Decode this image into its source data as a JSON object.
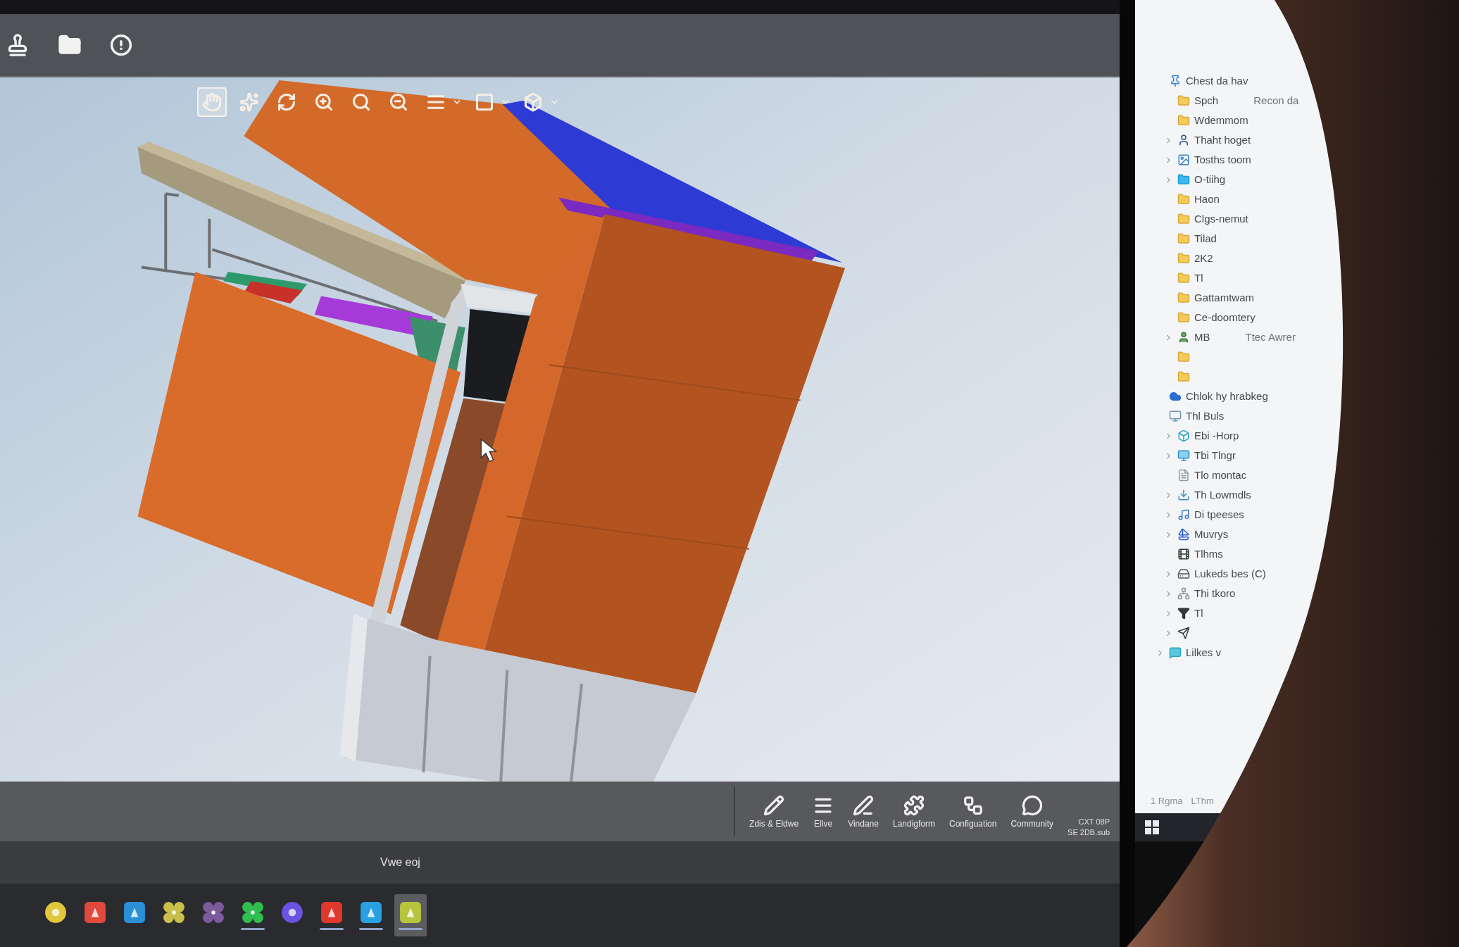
{
  "viewport_toolbar": {
    "tools": [
      {
        "selected": true,
        "dropdown": false
      },
      {
        "selected": false,
        "dropdown": false
      },
      {
        "selected": false,
        "dropdown": false
      },
      {
        "selected": false,
        "dropdown": false
      },
      {
        "selected": false,
        "dropdown": false
      },
      {
        "selected": false,
        "dropdown": false
      },
      {
        "selected": false,
        "dropdown": true
      },
      {
        "selected": false,
        "dropdown": true
      },
      {
        "selected": false,
        "dropdown": true
      }
    ]
  },
  "ribbon": {
    "tools": [
      {
        "label": "Zdis & Eldwe"
      },
      {
        "label": "Ellve"
      },
      {
        "label": "Vindane"
      },
      {
        "label": "Landigform"
      },
      {
        "label": "Configuation"
      },
      {
        "label": "Community"
      }
    ],
    "clock": {
      "time": "CXT 08P",
      "date": "SE 2DB.sub"
    }
  },
  "monitor": {
    "label": "Vwe eoj"
  },
  "taskbar": {
    "apps": [
      {
        "kind": "circle",
        "color": "#e2c63c",
        "running": false,
        "selected": false
      },
      {
        "kind": "square",
        "color": "#e04a3c",
        "running": false,
        "selected": false
      },
      {
        "kind": "square",
        "color": "#2b8fd8",
        "running": false,
        "selected": false
      },
      {
        "kind": "cluster",
        "color": "#c8c04a",
        "running": false,
        "selected": false
      },
      {
        "kind": "cluster",
        "color": "#7c5a9c",
        "running": false,
        "selected": false
      },
      {
        "kind": "cluster",
        "color": "#2fbf4f",
        "running": true,
        "selected": false
      },
      {
        "kind": "circle",
        "color": "#6b52e0",
        "running": false,
        "selected": false
      },
      {
        "kind": "square",
        "color": "#e0382c",
        "running": true,
        "selected": false
      },
      {
        "kind": "square",
        "color": "#2a9fe2",
        "running": true,
        "selected": false
      },
      {
        "kind": "square",
        "color": "#b8c43c",
        "running": true,
        "selected": true
      }
    ]
  },
  "explorer": {
    "tree": [
      {
        "label": "Chest da hav",
        "kind": "pin",
        "expander": false,
        "children": [
          {
            "label": "Spch",
            "note": "Recon da",
            "kind": "folder",
            "expander": false
          },
          {
            "label": "Wdemmom",
            "kind": "folder",
            "expander": false
          },
          {
            "label": "Thaht hoget",
            "kind": "user",
            "expander": true
          },
          {
            "label": "Tosths toom",
            "kind": "image",
            "expander": true
          },
          {
            "label": "O-tiihg",
            "kind": "bluefolder",
            "expander": true
          },
          {
            "label": "Haon",
            "kind": "folder",
            "expander": false
          },
          {
            "label": "Clgs-nemut",
            "kind": "folder",
            "expander": false
          },
          {
            "label": "Tilad",
            "kind": "folder",
            "expander": false
          },
          {
            "label": "2K2",
            "kind": "folder",
            "expander": false
          },
          {
            "label": "Tl",
            "kind": "folder",
            "expander": false
          },
          {
            "label": "Gattamtwam",
            "kind": "folder",
            "expander": false
          },
          {
            "label": "Ce-doomtery",
            "kind": "folder",
            "expander": false
          },
          {
            "label": "MB",
            "note": "Ttec Awrer",
            "kind": "share",
            "expander": true
          },
          {
            "kind": "folder",
            "expander": false
          },
          {
            "kind": "folder",
            "expander": false
          }
        ]
      },
      {
        "label": "Chlok hy hrabkeg",
        "kind": "cloud",
        "expander": false
      },
      {
        "label": "Thl Buls",
        "kind": "computer",
        "expander": false,
        "children": [
          {
            "label": "Ebi -Horp",
            "kind": "cube",
            "expander": true
          },
          {
            "label": "Tbi Tlngr",
            "kind": "desktop",
            "expander": true
          },
          {
            "label": "Tlo montac",
            "kind": "document",
            "expander": false
          },
          {
            "label": "Th Lowmdls",
            "kind": "download",
            "expander": true
          },
          {
            "label": "Di tpeeses",
            "kind": "music",
            "expander": true
          },
          {
            "label": "Muvrys",
            "kind": "sail",
            "expander": true
          },
          {
            "label": "Tlhms",
            "kind": "video",
            "expander": false
          },
          {
            "label": "Lukeds bes (C)",
            "kind": "disk",
            "expander": true
          },
          {
            "label": "Thi tkoro",
            "kind": "network",
            "expander": true
          },
          {
            "label": "Tl",
            "kind": "filter",
            "expander": true
          },
          {
            "kind": "send",
            "expander": true
          }
        ]
      },
      {
        "label": "Lilkes v",
        "kind": "chat",
        "expander": true
      }
    ],
    "status_bar": {
      "count": "1 Rgma",
      "selection": "LThm"
    }
  }
}
